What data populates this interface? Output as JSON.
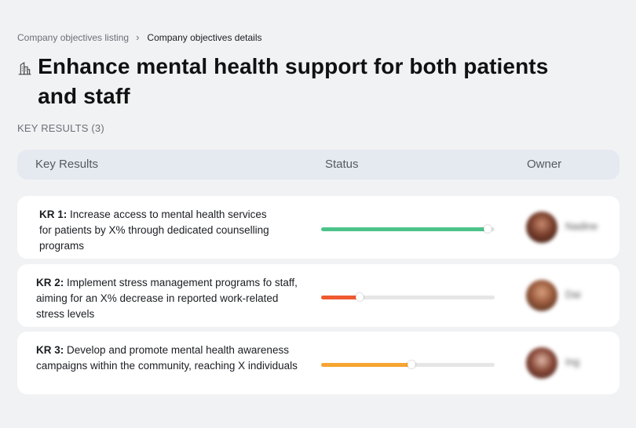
{
  "breadcrumb": {
    "parent": "Company objectives listing",
    "separator": "›",
    "current": "Company objectives details"
  },
  "page": {
    "title": "Enhance mental health support for both patients and staff",
    "title_icon": "building-icon"
  },
  "section": {
    "label": "KEY RESULTS (3)"
  },
  "table": {
    "columns": {
      "key_results": "Key Results",
      "status": "Status",
      "owner": "Owner"
    }
  },
  "key_results": [
    {
      "id": "KR 1:",
      "text": "Increase access to mental health services for patients by X% through dedicated counselling programs",
      "progress": 0.96,
      "color": "#4cc38a",
      "owner": "Nadine"
    },
    {
      "id": "KR 2:",
      "text": "Implement stress management programs fo staff, aiming for an X% decrease in reported work-related stress levels",
      "progress": 0.22,
      "color": "#ef5a2f",
      "owner": "Dai"
    },
    {
      "id": "KR 3:",
      "text": "Develop and promote mental health awareness campaigns within the community, reaching X individuals",
      "progress": 0.52,
      "color": "#f5a530",
      "owner": "Ing"
    }
  ]
}
